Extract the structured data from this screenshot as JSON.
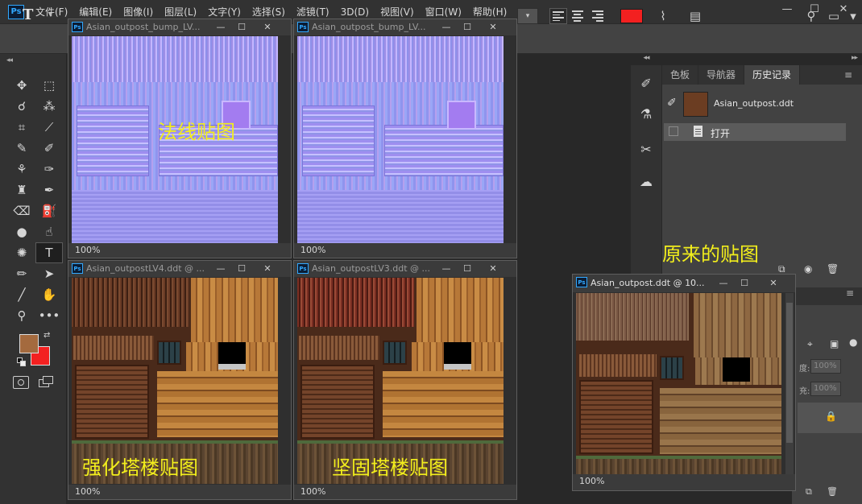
{
  "menu": {
    "logo": "Ps",
    "items": [
      "文件(F)",
      "编辑(E)",
      "图像(I)",
      "图层(L)",
      "文字(Y)",
      "选择(S)",
      "滤镜(T)",
      "3D(D)",
      "视图(V)",
      "窗口(W)",
      "帮助(H)"
    ]
  },
  "window_controls": {
    "minimize": "—",
    "maximize": "☐",
    "close": "✕"
  },
  "options_bar": {
    "tool_glyph": "T",
    "dropdown_arrow": "▾",
    "text_color": "#f32020"
  },
  "toolbar": {
    "collapse": "◂◂",
    "foreground_color": "#a46a3e",
    "background_color": "#f32020"
  },
  "history_panel": {
    "tabs": [
      "色板",
      "导航器",
      "历史记录"
    ],
    "active_tab": "历史记录",
    "snapshot_name": "Asian_outpost.ddt",
    "states": [
      "打开"
    ]
  },
  "layers_panel": {
    "opacity_value": "100%",
    "fill_value": "100%",
    "opacity_label": "度:",
    "fill_label": "充:"
  },
  "docs": [
    {
      "name": "Asian_outpost_bump_LV...",
      "zoom": "100%"
    },
    {
      "name": "Asian_outpost_bump_LV...",
      "zoom": "100%"
    },
    {
      "name": "Asian_outpostLV4.ddt @ ...",
      "zoom": "100%"
    },
    {
      "name": "Asian_outpostLV3.ddt @ ...",
      "zoom": "100%"
    },
    {
      "name": "Asian_outpost.ddt @ 10...",
      "zoom": "100%"
    }
  ],
  "annotations": {
    "normal_map": "法线贴图",
    "original_map": "原来的贴图",
    "enhanced_map": "强化塔楼贴图",
    "solid_map": "坚固塔楼贴图"
  },
  "icons": {
    "menu_panel": "panel-menu-icon",
    "history_brush": "history-brush-icon",
    "lock": "lock-icon"
  }
}
